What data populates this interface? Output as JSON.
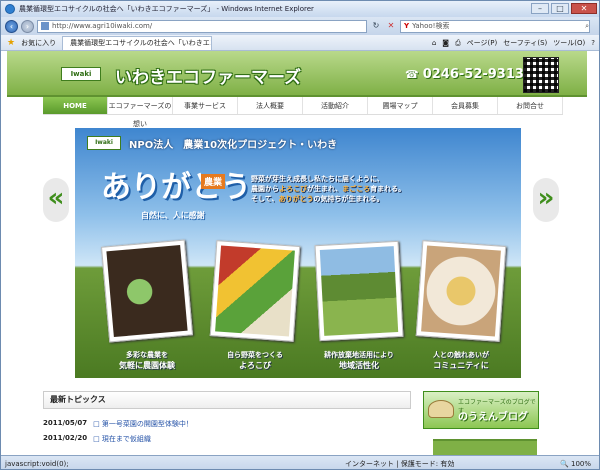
{
  "browser": {
    "title": "農業循環型エコサイクルの社会へ「いわきエコファーマーズ」 - Windows Internet Explorer",
    "address": "http://www.agri10iwaki.com/",
    "search_placeholder": "Yahoo!検索",
    "favorites_label": "お気に入り",
    "tab_label": "農業循環型エコサイクルの社会へ「いわきエコ...",
    "cmd_page": "ページ(P)",
    "cmd_safety": "セーフティ(S)",
    "cmd_tools": "ツール(O)",
    "min_label": "–",
    "max_label": "□",
    "close_label": "✕"
  },
  "site": {
    "logo": "Iwaki",
    "name": "いわきエコファーマーズ",
    "tel_icon": "☎",
    "tel": "0246-52-9313"
  },
  "nav": [
    "HOME",
    "エコファーマーズの想い",
    "事業サービス",
    "法人概要",
    "活動紹介",
    "圃場マップ",
    "会員募集",
    "お問合せ"
  ],
  "hero": {
    "badge": "Iwaki",
    "npo": "NPO法人　農業10次化プロジェクト・いわき",
    "big": "ありがとう",
    "nou": "農業",
    "sub": "自然に、人に感謝",
    "line1a": "野菜が芽生え成長し私たちに届くように、",
    "line2a": "農園から",
    "line2b": "よろこび",
    "line2c": "が生まれ、",
    "line2d": "まごころ",
    "line2e": "育まれる。",
    "line3a": "そして、",
    "line3b": "ありがとう",
    "line3c": "の気持ちが生まれる。",
    "captions": [
      {
        "a": "多彩な農業を",
        "b": "気軽に農園体験"
      },
      {
        "a": "自ら野菜をつくる",
        "b": "よろこび"
      },
      {
        "a": "耕作放棄地活用により",
        "b": "地域活性化"
      },
      {
        "a": "人との触れあいが",
        "b": "コミュニティに"
      }
    ]
  },
  "arrows": {
    "left": "«",
    "right": "»"
  },
  "topics": {
    "title": "最新トピックス",
    "items": [
      {
        "date": "2011/05/07",
        "text": "□ 第一号菜園の開園型体験中！"
      },
      {
        "date": "2011/02/20",
        "text": "□ 現在まで仮組織"
      }
    ]
  },
  "blog": {
    "small": "エコファーマーズのブログです",
    "big": "のうえんブログ"
  },
  "status": {
    "left": "javascript:void(0);",
    "internet": "インターネット | 保護モード: 有効",
    "zoom": "🔍 100%"
  }
}
